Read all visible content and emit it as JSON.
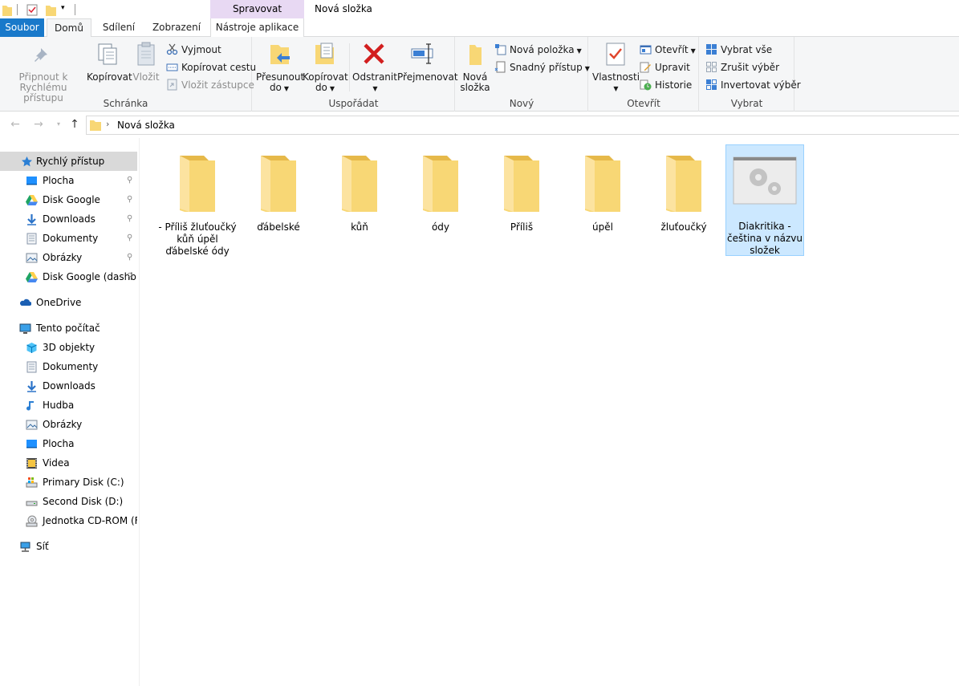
{
  "title_bar": {
    "context_group": "Spravovat",
    "window_title": "Nová složka"
  },
  "tabs": {
    "file": "Soubor",
    "home": "Domů",
    "share": "Sdílení",
    "view": "Zobrazení",
    "app_tools": "Nástroje aplikace"
  },
  "ribbon": {
    "clipboard": {
      "label": "Schránka",
      "pin_quick_access": [
        "Připnout k",
        "Rychlému přístupu"
      ],
      "copy": "Kopírovat",
      "paste": "Vložit",
      "cut": "Vyjmout",
      "copy_path": "Kopírovat cestu",
      "paste_shortcut": "Vložit zástupce"
    },
    "organize": {
      "label": "Uspořádat",
      "move_to": [
        "Přesunout",
        "do"
      ],
      "copy_to": [
        "Kopírovat",
        "do"
      ],
      "delete": "Odstranit",
      "rename": "Přejmenovat"
    },
    "new": {
      "label": "Nový",
      "new_folder": [
        "Nová",
        "složka"
      ],
      "new_item": "Nová položka",
      "easy_access": "Snadný přístup"
    },
    "open": {
      "label": "Otevřít",
      "properties": "Vlastnosti",
      "open": "Otevřít",
      "edit": "Upravit",
      "history": "Historie"
    },
    "select": {
      "label": "Vybrat",
      "select_all": "Vybrat vše",
      "select_none": "Zrušit výběr",
      "invert": "Invertovat výběr"
    }
  },
  "address": {
    "crumb": "Nová složka"
  },
  "nav_pane": {
    "quick_access": "Rychlý přístup",
    "quick_items": [
      {
        "label": "Plocha",
        "icon": "desktop-icon"
      },
      {
        "label": "Disk Google",
        "icon": "google-drive-icon"
      },
      {
        "label": "Downloads",
        "icon": "downloads-icon"
      },
      {
        "label": "Dokumenty",
        "icon": "documents-icon"
      },
      {
        "label": "Obrázky",
        "icon": "pictures-icon"
      },
      {
        "label": "Disk Google (dashb",
        "icon": "google-drive-icon"
      }
    ],
    "onedrive": "OneDrive",
    "this_pc": "Tento počítač",
    "pc_items": [
      {
        "label": "3D objekty",
        "icon": "3d-objects-icon"
      },
      {
        "label": "Dokumenty",
        "icon": "documents-icon"
      },
      {
        "label": "Downloads",
        "icon": "downloads-icon"
      },
      {
        "label": "Hudba",
        "icon": "music-icon"
      },
      {
        "label": "Obrázky",
        "icon": "pictures-icon"
      },
      {
        "label": "Plocha",
        "icon": "desktop-icon"
      },
      {
        "label": "Videa",
        "icon": "videos-icon"
      },
      {
        "label": "Primary Disk (C:)",
        "icon": "system-drive-icon"
      },
      {
        "label": "Second Disk (D:)",
        "icon": "drive-icon"
      },
      {
        "label": "Jednotka CD-ROM (F:)",
        "icon": "cd-drive-icon"
      }
    ],
    "network": "Síť"
  },
  "files": [
    {
      "name": "- Příliš žluťoučký kůň úpěl ďábelské ódy",
      "type": "folder"
    },
    {
      "name": "ďábelské",
      "type": "folder"
    },
    {
      "name": "kůň",
      "type": "folder"
    },
    {
      "name": "ódy",
      "type": "folder"
    },
    {
      "name": "Příliš",
      "type": "folder"
    },
    {
      "name": "úpěl",
      "type": "folder"
    },
    {
      "name": "žluťoučký",
      "type": "folder"
    },
    {
      "name": "Diakritika - čeština v názvu složek",
      "type": "application",
      "selected": true
    }
  ],
  "colors": {
    "file_tab": "#1979ca",
    "context_group": "#e8d9f3",
    "selection": "#cce8ff",
    "folder": "#f8d775"
  }
}
